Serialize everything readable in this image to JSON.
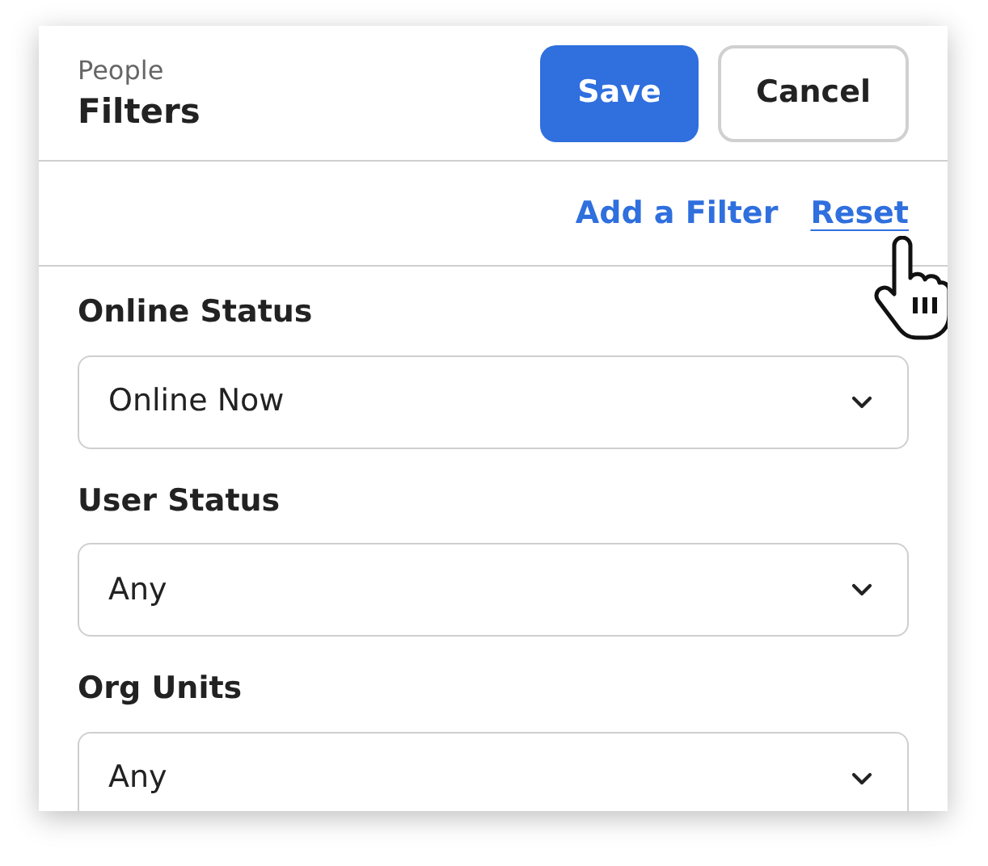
{
  "header": {
    "subtitle": "People",
    "title": "Filters"
  },
  "buttons": [
    {
      "label": "Save",
      "kind": "primary"
    },
    {
      "label": "Cancel",
      "kind": "secondary"
    }
  ],
  "links": [
    {
      "label": "Add a Filter",
      "selected": false
    },
    {
      "label": "Reset",
      "selected": true
    }
  ],
  "filters": [
    {
      "label": "Online Status",
      "value": "Online Now"
    },
    {
      "label": "User Status",
      "value": "Any"
    },
    {
      "label": "Org Units",
      "value": "Any"
    }
  ]
}
